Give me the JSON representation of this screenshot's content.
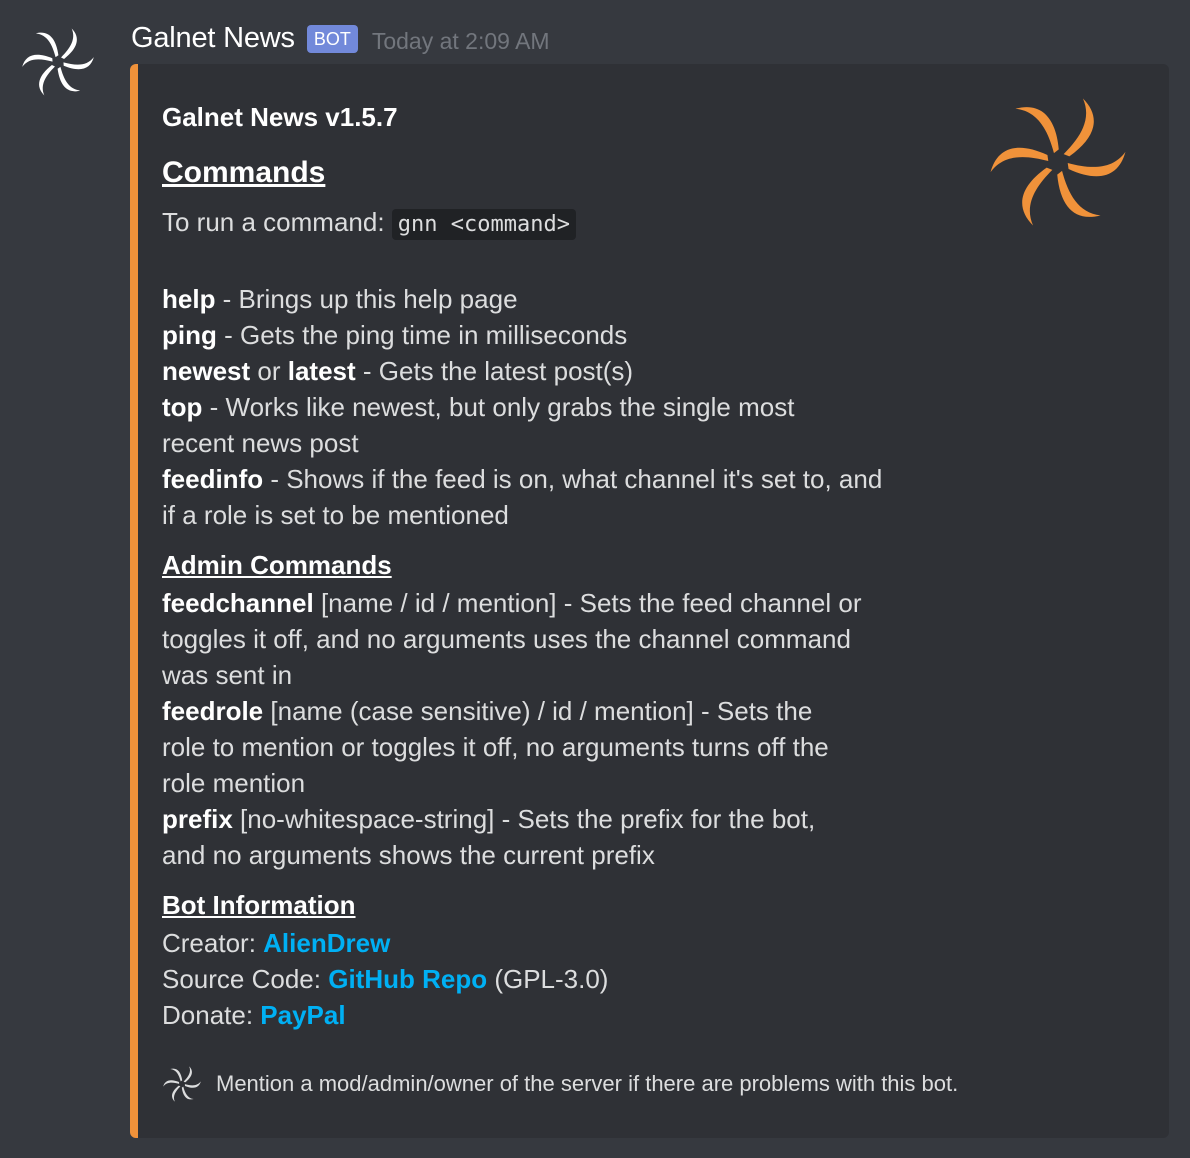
{
  "message": {
    "username": "Galnet News",
    "bot_tag": "BOT",
    "timestamp": "Today at 2:09 AM"
  },
  "embed": {
    "accent_color": "#f0923a",
    "title": "Galnet News v1.5.7",
    "commands_heading": "Commands",
    "intro_text": "To run a command: ",
    "intro_code": "gnn <command>",
    "commands": [
      {
        "cmd": "help",
        "text": " - Brings up this help page"
      },
      {
        "cmd": "ping",
        "text": " - Gets the ping time in milliseconds"
      },
      {
        "cmd": "newest",
        "mid": " or ",
        "cmd2": "latest",
        "text": " - Gets the latest post(s)"
      },
      {
        "cmd": "top",
        "text": " - Works like newest, but only grabs the single most",
        "text2": "recent news post"
      },
      {
        "cmd": "feedinfo",
        "text": " - Shows if the feed is on, what channel it's set to, and",
        "text2": "if a role is set to be mentioned"
      }
    ],
    "admin_heading": "Admin Commands",
    "admin_commands": [
      {
        "cmd": "feedchannel",
        "text": " [name / id / mention] - Sets the feed channel or",
        "text2": "toggles it off, and no arguments uses the channel command",
        "text3": "was sent in"
      },
      {
        "cmd": "feedrole",
        "text": " [name (case sensitive) / id / mention] - Sets the",
        "text2": "role to mention or toggles it off, no arguments turns off the",
        "text3": "role mention"
      },
      {
        "cmd": "prefix",
        "text": " [no-whitespace-string] - Sets the prefix for the bot,",
        "text2": "and no arguments shows the current prefix"
      }
    ],
    "info_heading": "Bot Information",
    "info": {
      "creator_label": "Creator: ",
      "creator_link": "AlienDrew",
      "source_label": "Source Code: ",
      "source_link": "GitHub Repo",
      "source_suffix": " (GPL-3.0)",
      "donate_label": "Donate: ",
      "donate_link": "PayPal"
    },
    "footer_text": "Mention a mod/admin/owner of the server if there are problems with this bot."
  },
  "colors": {
    "link": "#00b0f4",
    "thumbnail_logo": "#f0923a",
    "bot_tag": "#7289da"
  },
  "icons": [
    "galnet-swirl-icon"
  ]
}
